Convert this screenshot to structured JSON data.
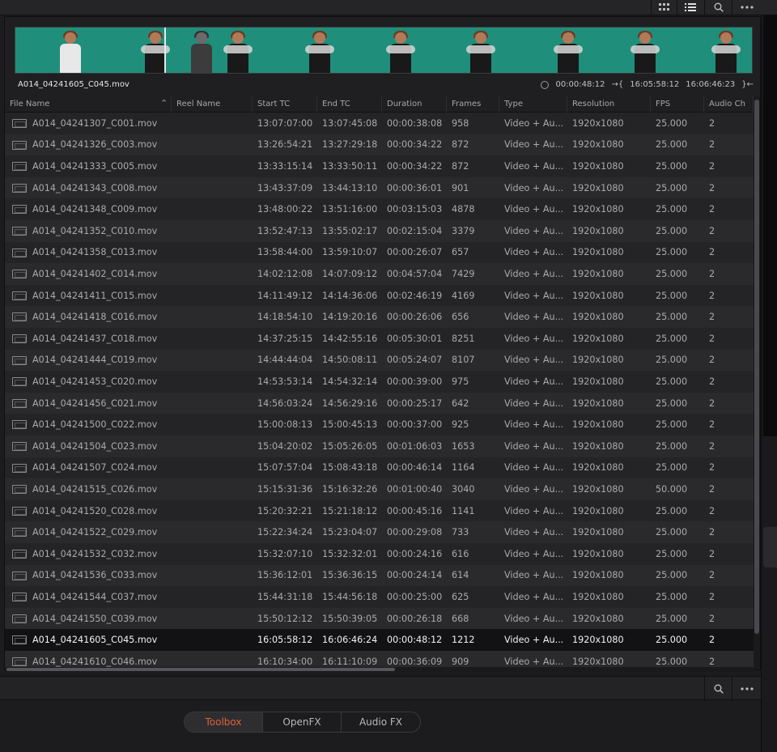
{
  "toolbar": {
    "grid_view_icon": "grid-icon",
    "list_view_icon": "list-icon",
    "search_icon": "search-icon",
    "more_icon": "ellipsis-icon"
  },
  "viewer": {
    "clip_name": "A014_04241605_C045.mov",
    "duration": "00:00:48:12",
    "in_tc": "16:05:58:12",
    "out_tc": "16:06:46:23"
  },
  "table": {
    "columns": [
      "File Name",
      "Reel Name",
      "Start TC",
      "End TC",
      "Duration",
      "Frames",
      "Type",
      "Resolution",
      "FPS",
      "Audio Ch"
    ],
    "rows": [
      [
        "A014_04241307_C001.mov",
        "",
        "13:07:07:00",
        "13:07:45:08",
        "00:00:38:08",
        "958",
        "Video + Au...",
        "1920x1080",
        "25.000",
        "2"
      ],
      [
        "A014_04241326_C003.mov",
        "",
        "13:26:54:21",
        "13:27:29:18",
        "00:00:34:22",
        "872",
        "Video + Au...",
        "1920x1080",
        "25.000",
        "2"
      ],
      [
        "A014_04241333_C005.mov",
        "",
        "13:33:15:14",
        "13:33:50:11",
        "00:00:34:22",
        "872",
        "Video + Au...",
        "1920x1080",
        "25.000",
        "2"
      ],
      [
        "A014_04241343_C008.mov",
        "",
        "13:43:37:09",
        "13:44:13:10",
        "00:00:36:01",
        "901",
        "Video + Au...",
        "1920x1080",
        "25.000",
        "2"
      ],
      [
        "A014_04241348_C009.mov",
        "",
        "13:48:00:22",
        "13:51:16:00",
        "00:03:15:03",
        "4878",
        "Video + Au...",
        "1920x1080",
        "25.000",
        "2"
      ],
      [
        "A014_04241352_C010.mov",
        "",
        "13:52:47:13",
        "13:55:02:17",
        "00:02:15:04",
        "3379",
        "Video + Au...",
        "1920x1080",
        "25.000",
        "2"
      ],
      [
        "A014_04241358_C013.mov",
        "",
        "13:58:44:00",
        "13:59:10:07",
        "00:00:26:07",
        "657",
        "Video + Au...",
        "1920x1080",
        "25.000",
        "2"
      ],
      [
        "A014_04241402_C014.mov",
        "",
        "14:02:12:08",
        "14:07:09:12",
        "00:04:57:04",
        "7429",
        "Video + Au...",
        "1920x1080",
        "25.000",
        "2"
      ],
      [
        "A014_04241411_C015.mov",
        "",
        "14:11:49:12",
        "14:14:36:06",
        "00:02:46:19",
        "4169",
        "Video + Au...",
        "1920x1080",
        "25.000",
        "2"
      ],
      [
        "A014_04241418_C016.mov",
        "",
        "14:18:54:10",
        "14:19:20:16",
        "00:00:26:06",
        "656",
        "Video + Au...",
        "1920x1080",
        "25.000",
        "2"
      ],
      [
        "A014_04241437_C018.mov",
        "",
        "14:37:25:15",
        "14:42:55:16",
        "00:05:30:01",
        "8251",
        "Video + Au...",
        "1920x1080",
        "25.000",
        "2"
      ],
      [
        "A014_04241444_C019.mov",
        "",
        "14:44:44:04",
        "14:50:08:11",
        "00:05:24:07",
        "8107",
        "Video + Au...",
        "1920x1080",
        "25.000",
        "2"
      ],
      [
        "A014_04241453_C020.mov",
        "",
        "14:53:53:14",
        "14:54:32:14",
        "00:00:39:00",
        "975",
        "Video + Au...",
        "1920x1080",
        "25.000",
        "2"
      ],
      [
        "A014_04241456_C021.mov",
        "",
        "14:56:03:24",
        "14:56:29:16",
        "00:00:25:17",
        "642",
        "Video + Au...",
        "1920x1080",
        "25.000",
        "2"
      ],
      [
        "A014_04241500_C022.mov",
        "",
        "15:00:08:13",
        "15:00:45:13",
        "00:00:37:00",
        "925",
        "Video + Au...",
        "1920x1080",
        "25.000",
        "2"
      ],
      [
        "A014_04241504_C023.mov",
        "",
        "15:04:20:02",
        "15:05:26:05",
        "00:01:06:03",
        "1653",
        "Video + Au...",
        "1920x1080",
        "25.000",
        "2"
      ],
      [
        "A014_04241507_C024.mov",
        "",
        "15:07:57:04",
        "15:08:43:18",
        "00:00:46:14",
        "1164",
        "Video + Au...",
        "1920x1080",
        "25.000",
        "2"
      ],
      [
        "A014_04241515_C026.mov",
        "",
        "15:15:31:36",
        "15:16:32:26",
        "00:01:00:40",
        "3040",
        "Video + Au...",
        "1920x1080",
        "50.000",
        "2"
      ],
      [
        "A014_04241520_C028.mov",
        "",
        "15:20:32:21",
        "15:21:18:12",
        "00:00:45:16",
        "1141",
        "Video + Au...",
        "1920x1080",
        "25.000",
        "2"
      ],
      [
        "A014_04241522_C029.mov",
        "",
        "15:22:34:24",
        "15:23:04:07",
        "00:00:29:08",
        "733",
        "Video + Au...",
        "1920x1080",
        "25.000",
        "2"
      ],
      [
        "A014_04241532_C032.mov",
        "",
        "15:32:07:10",
        "15:32:32:01",
        "00:00:24:16",
        "616",
        "Video + Au...",
        "1920x1080",
        "25.000",
        "2"
      ],
      [
        "A014_04241536_C033.mov",
        "",
        "15:36:12:01",
        "15:36:36:15",
        "00:00:24:14",
        "614",
        "Video + Au...",
        "1920x1080",
        "25.000",
        "2"
      ],
      [
        "A014_04241544_C037.mov",
        "",
        "15:44:31:18",
        "15:44:56:18",
        "00:00:25:00",
        "625",
        "Video + Au...",
        "1920x1080",
        "25.000",
        "2"
      ],
      [
        "A014_04241550_C039.mov",
        "",
        "15:50:12:12",
        "15:50:39:05",
        "00:00:26:18",
        "668",
        "Video + Au...",
        "1920x1080",
        "25.000",
        "2"
      ],
      [
        "A014_04241605_C045.mov",
        "",
        "16:05:58:12",
        "16:06:46:24",
        "00:00:48:12",
        "1212",
        "Video + Au...",
        "1920x1080",
        "25.000",
        "2"
      ],
      [
        "A014_04241610_C046.mov",
        "",
        "16:10:34:00",
        "16:11:10:09",
        "00:00:36:09",
        "909",
        "Video + Au...",
        "1920x1080",
        "25.000",
        "2"
      ]
    ],
    "selected_index": 24
  },
  "bottom_tabs": [
    "Toolbox",
    "OpenFX",
    "Audio FX"
  ],
  "active_tab_color": "#e0603a"
}
